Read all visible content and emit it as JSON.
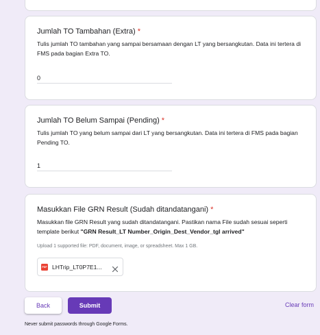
{
  "questions": [
    {
      "title": "Jumlah TO Tambahan (Extra)",
      "required_mark": "*",
      "description": "Tulis jumlah TO tambahan yang sampai bersamaan dengan LT yang bersangkutan. Data ini  tertera di FMS pada bagian Extra TO.",
      "value": "0"
    },
    {
      "title": "Jumlah TO Belum Sampai (Pending)",
      "required_mark": "*",
      "description": "Tulis jumlah TO yang belum sampai dari LT yang bersangkutan. Data ini  tertera di FMS pada bagian Pending TO.",
      "value": "1"
    },
    {
      "title": "Masukkan File GRN Result (Sudah ditandatangani)",
      "required_mark": "*",
      "description_plain": "Masukkan file GRN Result yang sudah ditandatangani. Pastikan nama File sudah sesuai seperti template berikut ",
      "description_bold": "\"GRN Result_LT Number_Origin_Dest_Vendor_tgl arrived\"",
      "upload_hint": "Upload 1 supported file: PDF, document, image, or spreadsheet. Max 1 GB.",
      "file": {
        "icon": "pdf-file-icon",
        "icon_label": "PDF",
        "name": "LHTrip_LT0P7E1...",
        "remove_icon": "close-icon"
      }
    }
  ],
  "navigation": {
    "back_label": "Back",
    "submit_label": "Submit",
    "clear_label": "Clear form"
  },
  "footer": {
    "note": "Never submit passwords through Google Forms."
  },
  "colors": {
    "page_background": "#f0ebf8",
    "accent": "#673ab7",
    "required": "#d93025",
    "pdf_icon": "#ea4335"
  }
}
